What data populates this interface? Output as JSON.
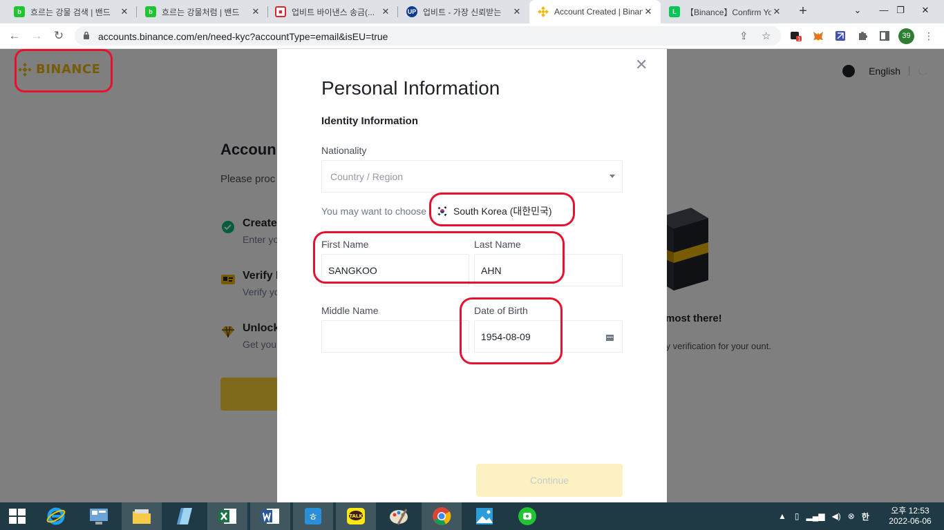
{
  "browser": {
    "tabs": [
      {
        "title": "흐르는 강물 검색 | 밴드",
        "favicon": "band-icon",
        "color": "#21c431",
        "active": false
      },
      {
        "title": "흐르는 강물처럼 | 밴드",
        "favicon": "band-icon",
        "color": "#21c431",
        "active": false
      },
      {
        "title": "업비트 바이낸스 송금(...",
        "favicon": "app-icon",
        "color": "#d62828",
        "active": false
      },
      {
        "title": "업비트 - 가장 신뢰받는",
        "favicon": "upbit-icon",
        "color": "#0a3b8c",
        "active": false
      },
      {
        "title": "Account Created | Binance",
        "favicon": "binance-icon",
        "color": "#f0b90b",
        "active": true
      },
      {
        "title": "【Binance】Confirm Your",
        "favicon": "line-icon",
        "color": "#06c755",
        "active": false
      }
    ],
    "url": "accounts.binance.com/en/need-kyc?accountType=email&isEU=true",
    "profile_badge": "39",
    "extension_badge": "1"
  },
  "header": {
    "logo": "BINANCE",
    "language": "English"
  },
  "background": {
    "title": "Accoun",
    "subtitle": "Please proc",
    "steps": [
      {
        "title": "Create",
        "sub": "Enter yo",
        "icon": "check-circle-icon"
      },
      {
        "title": "Verify I",
        "sub": "Verify yo",
        "icon": "id-card-icon"
      },
      {
        "title": "Unlock",
        "sub": "Get you",
        "icon": "diamond-icon"
      }
    ],
    "right_title": "most there!",
    "right_sub": "ity verification for your ount."
  },
  "modal": {
    "title": "Personal Information",
    "section": "Identity Information",
    "nationality_label": "Nationality",
    "nationality_placeholder": "Country / Region",
    "hint": "You may want to choose",
    "suggested_country": "South Korea (대한민국)",
    "first_name_label": "First Name",
    "first_name_value": "SANGKOO",
    "last_name_label": "Last Name",
    "last_name_value": "AHN",
    "middle_name_label": "Middle Name",
    "middle_name_value": "",
    "dob_label": "Date of Birth",
    "dob_value": "1954-08-09",
    "continue_label": "Continue"
  },
  "taskbar": {
    "apps": [
      "windows-start-icon",
      "internet-explorer-icon",
      "control-panel-icon",
      "file-explorer-icon",
      "notepad-icon",
      "excel-icon",
      "word-icon",
      "hangul-icon",
      "kakaotalk-icon",
      "paint-icon",
      "chrome-icon",
      "photos-icon",
      "band-app-icon"
    ],
    "ime": "한",
    "time": "오후 12:53",
    "date": "2022-06-06"
  },
  "colors": {
    "brand": "#f0b90b",
    "button": "#fcd535",
    "button_disabled": "#fcf1c3",
    "annotation": "#e8112d"
  }
}
